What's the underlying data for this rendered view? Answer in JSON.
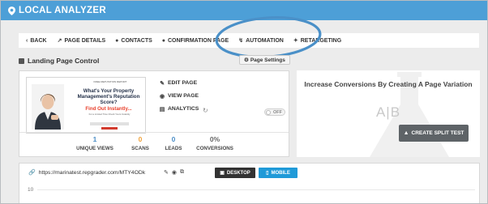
{
  "app": {
    "title": "LOCAL ANALYZER"
  },
  "nav": {
    "back": "BACK",
    "page_details": "PAGE DETAILS",
    "contacts": "CONTACTS",
    "confirmation_page": "CONFIRMATION PAGE",
    "automation": "AUTOMATION",
    "retargeting": "RETARGETING"
  },
  "section": {
    "title": "Landing Page Control",
    "page_settings": "Page Settings"
  },
  "thumbnail": {
    "header": "FREE REPUTATION REPORT",
    "headline": "What's Your Property Management's Reputation Score?",
    "cta": "Find Out Instantly...",
    "subtext": "For a Limited Time Check Yours Instantly"
  },
  "actions": {
    "edit_page": "EDIT PAGE",
    "view_page": "VIEW PAGE",
    "analytics": "ANALYTICS",
    "analytics_toggle": "OFF"
  },
  "stats": [
    {
      "value": "1",
      "label": "UNIQUE VIEWS"
    },
    {
      "value": "0",
      "label": "SCANS"
    },
    {
      "value": "0",
      "label": "LEADS"
    },
    {
      "value": "0%",
      "label": "CONVERSIONS"
    }
  ],
  "split_test": {
    "headline": "Increase Conversions By Creating A Page Variation",
    "ab": "A|B",
    "button": "CREATE SPLIT TEST"
  },
  "preview": {
    "url": "https://marinatest.repgrader.com/MTY4ODk",
    "desktop": "DESKTOP",
    "mobile": "MOBILE",
    "axis_tick": "10"
  },
  "colors": {
    "header": "#4d9fd7",
    "accent_blue": "#1f9ad8",
    "stat_blue": "#4d8fc7",
    "stat_orange": "#f0a23a",
    "ring": "#4a90c8"
  }
}
